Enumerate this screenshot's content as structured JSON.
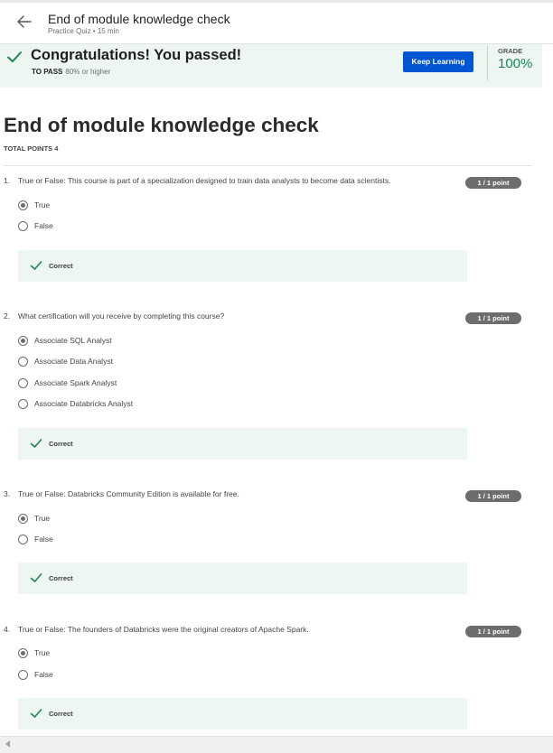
{
  "header": {
    "title": "End of module knowledge check",
    "subtitle": "Practice Quiz • 15 min"
  },
  "banner": {
    "title": "Congratulations! You passed!",
    "pass_label": "TO PASS",
    "pass_value": "80% or higher",
    "keep_learning": "Keep Learning",
    "grade_label": "GRADE",
    "grade_value": "100%"
  },
  "quiz": {
    "title": "End of module knowledge check",
    "total_points": "TOTAL POINTS 4",
    "questions": [
      {
        "number": "1.",
        "text": "True or False: This course is part of a specialization designed to train data analysts to become data scientists.",
        "points": "1 / 1 point",
        "options": [
          "True",
          "False"
        ],
        "selected": 0,
        "feedback": "Correct"
      },
      {
        "number": "2.",
        "text": "What certification will you receive by completing this course?",
        "points": "1 / 1 point",
        "options": [
          "Associate SQL Analyst",
          "Associate Data Analyst",
          "Associate Spark Analyst",
          "Associate Databricks Analyst"
        ],
        "selected": 0,
        "feedback": "Correct"
      },
      {
        "number": "3.",
        "text": "True or False: Databricks Community Edition is available for free.",
        "points": "1 / 1 point",
        "options": [
          "True",
          "False"
        ],
        "selected": 0,
        "feedback": "Correct"
      },
      {
        "number": "4.",
        "text": "True or False: The founders of Databricks were the original creators of Apache Spark.",
        "points": "1 / 1 point",
        "options": [
          "True",
          "False"
        ],
        "selected": 0,
        "feedback": "Correct"
      }
    ]
  },
  "icons": {
    "back": "arrow-left-icon",
    "passed": "checkmark-icon",
    "correct": "checkmark-icon",
    "scroll_left": "scroll-left-arrow-icon"
  },
  "colors": {
    "accent": "#0056d2",
    "success": "#1f8354",
    "banner_bg": "#eef6f2"
  }
}
